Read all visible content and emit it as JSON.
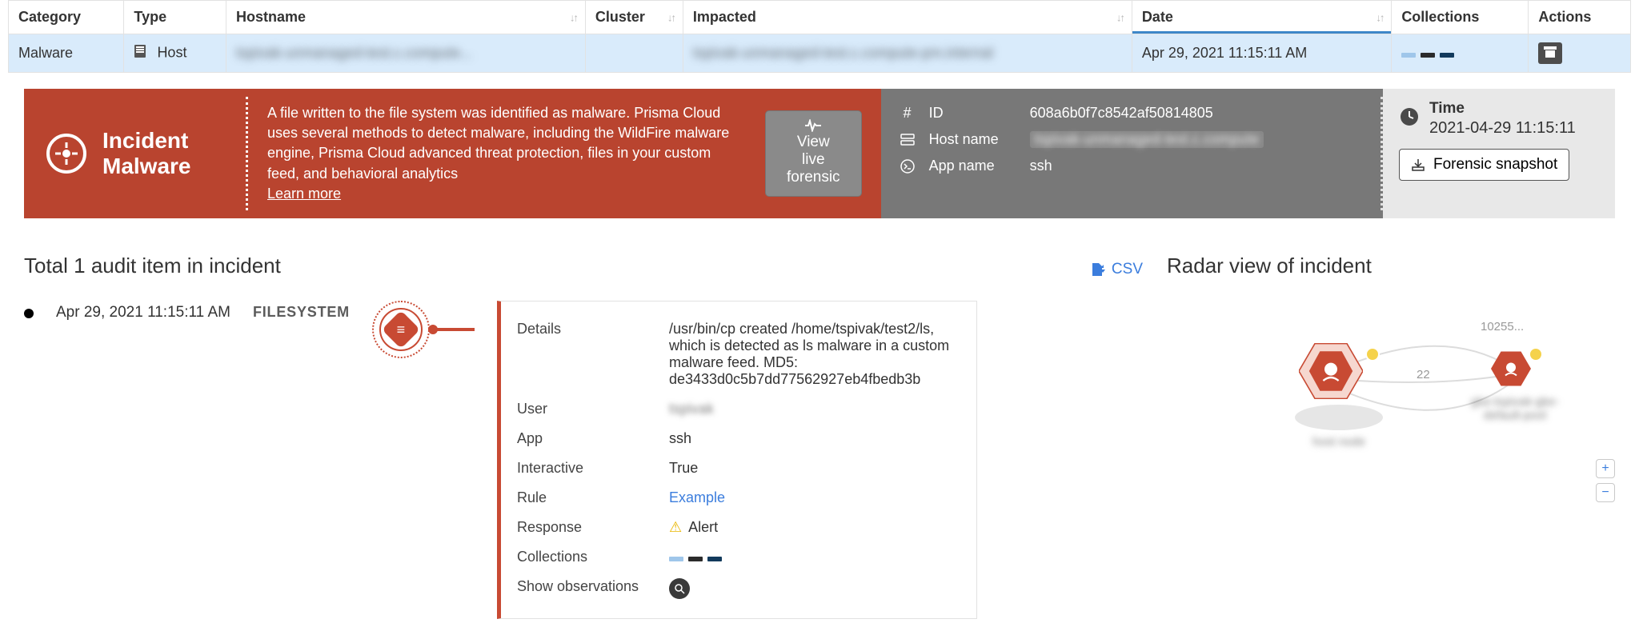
{
  "table": {
    "cols": {
      "category": "Category",
      "type": "Type",
      "hostname": "Hostname",
      "cluster": "Cluster",
      "impacted": "Impacted",
      "date": "Date",
      "collections": "Collections",
      "actions": "Actions"
    },
    "row": {
      "category": "Malware",
      "type": "Host",
      "hostname": "tspivak-unmanaged-test.c.compute...",
      "cluster": "",
      "impacted": "tspivak-unmanaged-test.c.compute-pm.internal",
      "date": "Apr 29, 2021 11:15:11 AM"
    }
  },
  "banner": {
    "title_line1": "Incident",
    "title_line2": "Malware",
    "desc": "A file written to the file system was identified as malware. Prisma Cloud uses several methods to detect malware, including the WildFire malware engine, Prisma Cloud advanced threat protection, files in your custom feed, and behavioral analytics",
    "learn_more": "Learn more",
    "live_btn": "View live forensic",
    "meta": {
      "id_label": "ID",
      "id": "608a6b0f7c8542af50814805",
      "host_label": "Host name",
      "host": "tspivak-unmanaged-test.c.compute",
      "app_label": "App name",
      "app": "ssh"
    },
    "time_label": "Time",
    "time": "2021-04-29 11:15:11",
    "snapshot": "Forensic snapshot"
  },
  "audit": {
    "heading": "Total 1 audit item in incident",
    "csv": "CSV",
    "item": {
      "date": "Apr 29, 2021 11:15:11 AM",
      "kind": "FILESYSTEM"
    },
    "detail": {
      "details_k": "Details",
      "details_v": "/usr/bin/cp created /home/tspivak/test2/ls, which is detected as ls malware in a custom malware feed. MD5: de3433d0c5b7dd77562927eb4fbedb3b",
      "user_k": "User",
      "user_v": "tspivak",
      "app_k": "App",
      "app_v": "ssh",
      "interactive_k": "Interactive",
      "interactive_v": "True",
      "rule_k": "Rule",
      "rule_v": "Example",
      "response_k": "Response",
      "response_v": "Alert",
      "collections_k": "Collections",
      "showobs_k": "Show observations"
    }
  },
  "radar": {
    "heading": "Radar view of incident",
    "edge1": "10255...",
    "edge2": "22",
    "node1": "host node",
    "node2": "gke-tspivak-gke-default-pool"
  }
}
